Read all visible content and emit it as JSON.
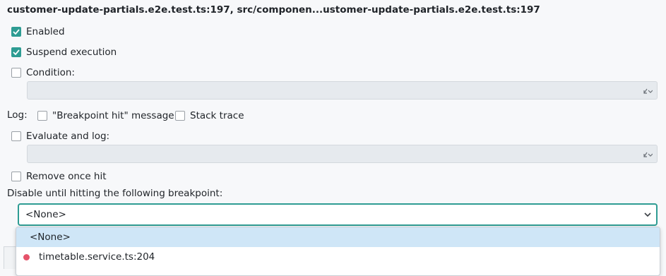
{
  "dialog": {
    "title": "customer-update-partials.e2e.test.ts:197, src/componen...ustomer-update-partials.e2e.test.ts:197"
  },
  "options": {
    "enabled": {
      "label": "Enabled",
      "checked": true
    },
    "suspend": {
      "label": "Suspend execution",
      "checked": true
    },
    "condition": {
      "label": "Condition:",
      "checked": false,
      "value": ""
    },
    "log_label": "Log:",
    "log_message": {
      "label": "\"Breakpoint hit\" message",
      "checked": false
    },
    "stack_trace": {
      "label": "Stack trace",
      "checked": false
    },
    "evaluate": {
      "label": "Evaluate and log:",
      "checked": false,
      "value": ""
    },
    "remove_once_hit": {
      "label": "Remove once hit",
      "checked": false
    },
    "disable_until_label": "Disable until hitting the following breakpoint:"
  },
  "breakpoint_select": {
    "selected": "<None>",
    "options": [
      {
        "label": "<None>",
        "selected": true
      },
      {
        "label": "timetable.service.ts:204",
        "icon": "breakpoint-dot-icon"
      }
    ]
  },
  "colors": {
    "accent": "#2e9c93",
    "breakpoint_dot": "#e5536a",
    "selection": "#cfe6f7"
  }
}
